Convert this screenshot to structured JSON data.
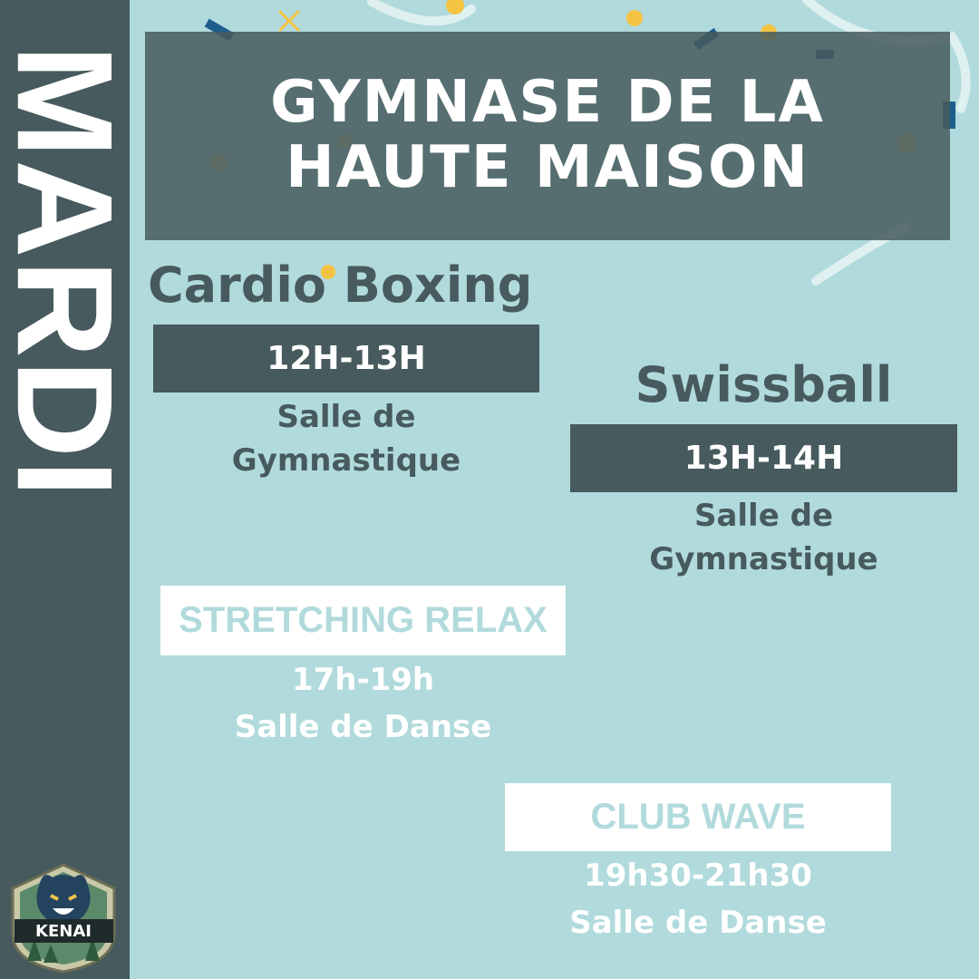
{
  "day": "MARDI",
  "title": {
    "line1": "GYMNASE DE LA",
    "line2": "HAUTE MAISON"
  },
  "classes": [
    {
      "name": "Cardio Boxing",
      "time": "12H-13H",
      "room_line1": "Salle de",
      "room_line2": "Gymnastique"
    },
    {
      "name": "Swissball",
      "time": "13H-14H",
      "room_line1": "Salle de",
      "room_line2": "Gymnastique"
    },
    {
      "name": "STRETCHING RELAX",
      "time": "17h-19h",
      "room": "Salle de Danse"
    },
    {
      "name": "CLUB WAVE",
      "time": "19h30-21h30",
      "room": "Salle de Danse"
    }
  ],
  "logo": {
    "text": "KENAI",
    "icon": "bear-shield-icon"
  },
  "colors": {
    "background": "#b1dadc",
    "dark": "#475a5d",
    "white": "#ffffff",
    "accent": "#f5c342"
  }
}
